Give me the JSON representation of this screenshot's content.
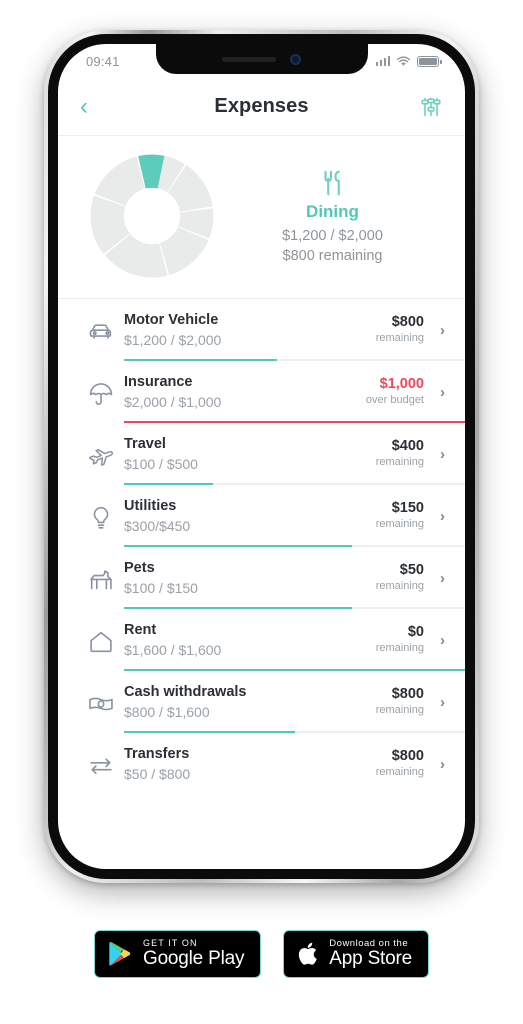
{
  "status_bar": {
    "time": "09:41",
    "signal_icon": "cellular-signal-icon",
    "wifi_icon": "wifi-icon",
    "battery_icon": "battery-icon"
  },
  "header": {
    "back_icon": "chevron-left-icon",
    "title": "Expenses",
    "filter_icon": "sliders-filter-icon"
  },
  "summary": {
    "category_icon": "fork-knife-dining-icon",
    "category": "Dining",
    "amount": "$1,200 / $2,000",
    "remaining": "$800 remaining",
    "accent_color": "#4fc9b8"
  },
  "chart_data": {
    "type": "pie",
    "title": "Expenses by category",
    "highlight": "Dining",
    "highlight_color": "#5ECCBC",
    "base_color": "#e9eaea",
    "categories": [
      "Dining",
      "Motor Vehicle",
      "Insurance",
      "Travel",
      "Utilities",
      "Pets",
      "Rent",
      "Cash withdrawals"
    ],
    "values": [
      7,
      9,
      13,
      8,
      14,
      18,
      16,
      15
    ],
    "legend": "none",
    "grid": false
  },
  "colors": {
    "teal": "#4fc9b8",
    "red": "#f0475b",
    "text_dark": "#2b2f36",
    "text_muted": "#9aa1a9"
  },
  "list": {
    "status_remaining": "remaining",
    "status_over": "over budget",
    "chevron_icon": "chevron-right-icon",
    "rows": [
      {
        "icon": "car-icon",
        "title": "Motor Vehicle",
        "sub": "$1,200 / $2,000",
        "value": "$800",
        "status": "remaining",
        "over": false,
        "progress": 45
      },
      {
        "icon": "umbrella-icon",
        "title": "Insurance",
        "sub": "$2,000 / $1,000",
        "value": "$1,000",
        "status": "over budget",
        "over": true,
        "progress": 100
      },
      {
        "icon": "airplane-icon",
        "title": "Travel",
        "sub": "$100 / $500",
        "value": "$400",
        "status": "remaining",
        "over": false,
        "progress": 26
      },
      {
        "icon": "lightbulb-icon",
        "title": "Utilities",
        "sub": "$300/$450",
        "value": "$150",
        "status": "remaining",
        "over": false,
        "progress": 67
      },
      {
        "icon": "dog-pets-icon",
        "title": "Pets",
        "sub": "$100 / $150",
        "value": "$50",
        "status": "remaining",
        "over": false,
        "progress": 67
      },
      {
        "icon": "home-rent-icon",
        "title": "Rent",
        "sub": "$1,600 / $1,600",
        "value": "$0",
        "status": "remaining",
        "over": false,
        "progress": 100
      },
      {
        "icon": "banknote-cash-icon",
        "title": "Cash withdrawals",
        "sub": "$800 / $1,600",
        "value": "$800",
        "status": "remaining",
        "over": false,
        "progress": 50
      },
      {
        "icon": "transfer-arrows-icon",
        "title": "Transfers",
        "sub": "$50 / $800",
        "value": "$800",
        "status": "remaining",
        "over": false,
        "progress": 0
      }
    ]
  },
  "store_badges": {
    "google_play": {
      "small": "GET IT ON",
      "big": "Google Play",
      "icon": "google-play-icon"
    },
    "app_store": {
      "small": "Download on the",
      "big": "App Store",
      "icon": "apple-logo-icon"
    }
  }
}
